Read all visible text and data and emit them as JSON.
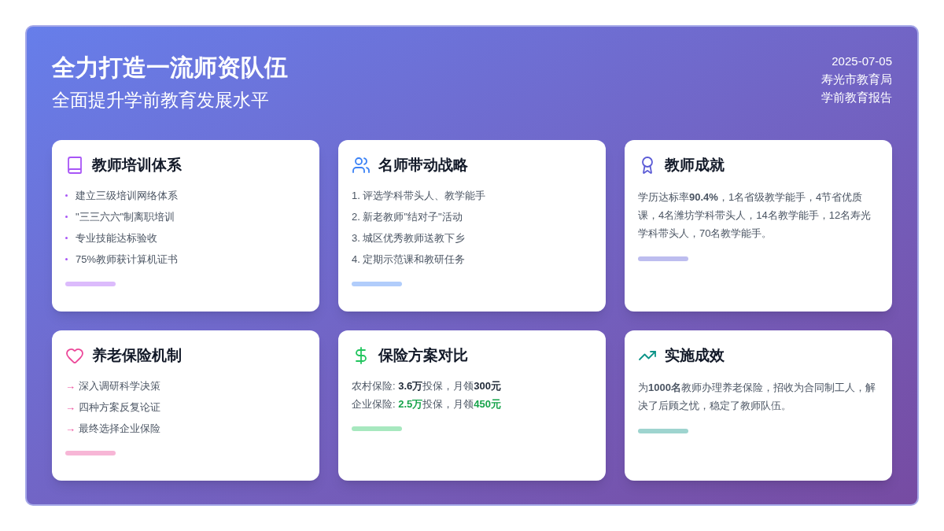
{
  "header": {
    "title": "全力打造一流师资队伍",
    "subtitle": "全面提升学前教育发展水平",
    "meta": [
      "2025-07-05",
      "寿光市教育局",
      "学前教育报告"
    ]
  },
  "cards": [
    {
      "kind": "bullets",
      "color": "#a855f7",
      "title": "教师培训体系",
      "items": [
        "建立三级培训网络体系",
        "\"三三六六\"制离职培训",
        "专业技能达标验收",
        "75%教师获计算机证书"
      ]
    },
    {
      "kind": "numbered",
      "color": "#3b82f6",
      "title": "名师带动战略",
      "items": [
        "1. 评选学科带头人、教学能手",
        "2. 新老教师\"结对子\"活动",
        "3. 城区优秀教师送教下乡",
        "4. 定期示范课和教研任务"
      ]
    },
    {
      "kind": "paragraph",
      "color": "#5b5bd6",
      "title": "教师成就",
      "text": "学历达标率**90.4%**，1名省级教学能手，4节省优质课，4名潍坊学科带头人，14名教学能手，12名寿光学科带头人，70名教学能手。"
    },
    {
      "kind": "arrows",
      "color": "#ec4899",
      "title": "养老保险机制",
      "items": [
        {
          "marker": "→",
          "text": "深入调研科学决策"
        },
        {
          "marker": "→",
          "text": "四种方案反复论证"
        },
        {
          "marker": "→",
          "text": "最终选择企业保险"
        }
      ]
    },
    {
      "kind": "comparison",
      "color": "#22c55e",
      "title": "保险方案对比",
      "lines": [
        {
          "label": "农村保险: ",
          "amount": "3.6万",
          "middle": "投保，月领",
          "pension": "300元",
          "color": "#1f2937"
        },
        {
          "label": "企业保险: ",
          "amount": "2.5万",
          "middle": "投保，月领",
          "pension": "450元",
          "color": "#16a34a"
        }
      ]
    },
    {
      "kind": "paragraph",
      "color": "#0d9488",
      "title": "实施成效",
      "text": "为**1000名**教师办理养老保险，招收为合同制工人，解决了后顾之忧，稳定了教师队伍。"
    }
  ]
}
